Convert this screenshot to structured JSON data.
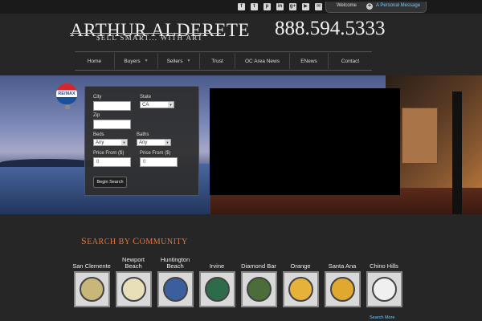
{
  "topbar": {
    "social_icons": [
      {
        "icon": "facebook-icon",
        "glyph": "f"
      },
      {
        "icon": "twitter-icon",
        "glyph": "t"
      },
      {
        "icon": "pinterest-icon",
        "glyph": "p"
      },
      {
        "icon": "linkedin-icon",
        "glyph": "in"
      },
      {
        "icon": "googleplus-icon",
        "glyph": "g+"
      },
      {
        "icon": "youtube-icon",
        "glyph": "▶"
      },
      {
        "icon": "email-icon",
        "glyph": "✉"
      }
    ],
    "welcome": "Welcome",
    "message_link": "A Personal Message"
  },
  "header": {
    "brand": "ARTHUR ALDERETE",
    "tagline": "$ELL SMART... WITH ART",
    "phone": "888.594.5333"
  },
  "nav": [
    {
      "label": "Home",
      "dropdown": false
    },
    {
      "label": "Buyers",
      "dropdown": true
    },
    {
      "label": "Sellers",
      "dropdown": true
    },
    {
      "label": "Trust",
      "dropdown": false
    },
    {
      "label": "OC Area News",
      "dropdown": false
    },
    {
      "label": "ENews",
      "dropdown": false
    },
    {
      "label": "Contact",
      "dropdown": false
    }
  ],
  "remax_logo": "RE/MAX",
  "search_form": {
    "city_label": "City",
    "city_value": "",
    "state_label": "State",
    "state_value": "CA",
    "zip_label": "Zip",
    "zip_value": "",
    "beds_label": "Beds",
    "beds_value": "Any",
    "baths_label": "Baths",
    "baths_value": "Any",
    "price_from_label": "Price From ($)",
    "price_from_value": "0",
    "price_to_label": "Price From ($)",
    "price_to_value": "0",
    "submit": "Begin Search"
  },
  "community": {
    "title_first": "S",
    "title_rest1": "EARCH BY ",
    "title_cap2": "C",
    "title_rest2": "OMMUNITY",
    "items": [
      {
        "name": "San Clemente",
        "seal_color": "#c9b77a"
      },
      {
        "name": "Newport Beach",
        "seal_color": "#e8dfb8"
      },
      {
        "name": "Huntington Beach",
        "seal_color": "#3b5f9e"
      },
      {
        "name": "Irvine",
        "seal_color": "#2d6b4a"
      },
      {
        "name": "Diamond Bar",
        "seal_color": "#4a6d3a"
      },
      {
        "name": "Orange",
        "seal_color": "#e6b23a"
      },
      {
        "name": "Santa Ana",
        "seal_color": "#e0a82e"
      },
      {
        "name": "Chino Hills",
        "seal_color": "#f0f0f0"
      }
    ],
    "more_link": "Search More"
  }
}
